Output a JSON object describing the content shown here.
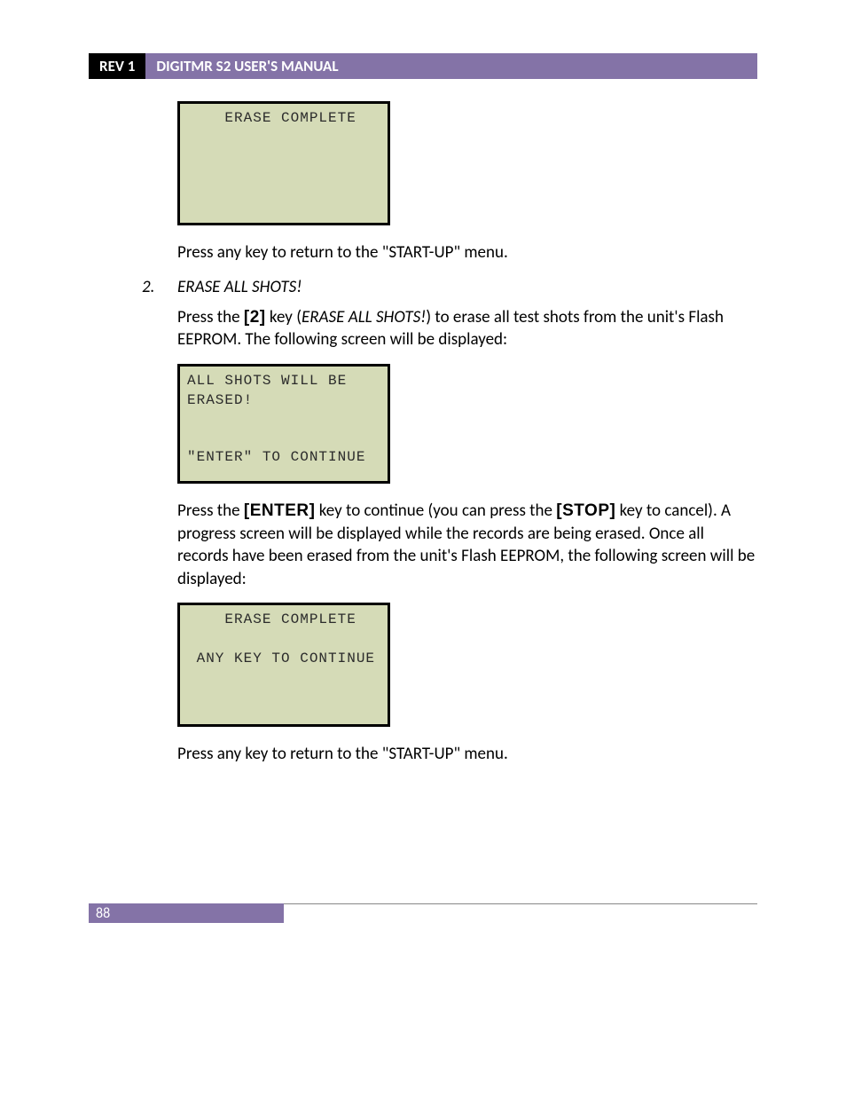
{
  "header": {
    "rev": "REV 1",
    "title": "DIGITMR S2 USER'S MANUAL"
  },
  "lcd1": {
    "line1": "    ERASE COMPLETE"
  },
  "para1": "Press any key to return to the \"START-UP\" menu.",
  "listItem": {
    "number": "2.",
    "heading": "ERASE ALL SHOTS!"
  },
  "para2a": "Press the ",
  "key2": "[2]",
  "para2b": " key (",
  "para2i": "ERASE ALL SHOTS!",
  "para2c": ") to erase all test shots from the unit's Flash EEPROM. The following screen will be displayed:",
  "lcd2": {
    "line1": "ALL SHOTS WILL BE",
    "line2": "ERASED!",
    "line3": "",
    "line4": "",
    "line5": "\"ENTER\" TO CONTINUE"
  },
  "para3a": "Press the ",
  "keyEnter": "[ENTER]",
  "para3b": " key to continue (you can press the ",
  "keyStop": "[STOP]",
  "para3c": " key to cancel). A progress screen will be displayed while the records are being erased. Once all records have been erased from the unit's Flash EEPROM, the following screen will be displayed:",
  "lcd3": {
    "line1": "    ERASE COMPLETE",
    "line2": "",
    "line3": " ANY KEY TO CONTINUE"
  },
  "para4": "Press any key to return to the \"START-UP\" menu.",
  "footer": {
    "page": "88"
  }
}
